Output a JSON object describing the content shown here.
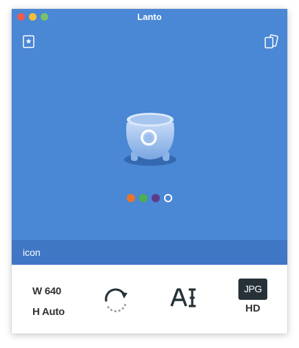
{
  "window": {
    "title": "Lanto"
  },
  "toolbar_icons": {
    "left": "bookmark-star-icon",
    "right": "copies-icon"
  },
  "preview": {
    "icon": "cauldron-icon",
    "caption": "icon"
  },
  "color_options": [
    {
      "name": "orange",
      "color": "#e8742e",
      "selected": false
    },
    {
      "name": "green",
      "color": "#4caf50",
      "selected": false
    },
    {
      "name": "purple",
      "color": "#5b3c8c",
      "selected": false
    },
    {
      "name": "white",
      "color": "#ffffff",
      "selected": true
    }
  ],
  "dimensions": {
    "width": "W 640",
    "height": "H Auto"
  },
  "format": {
    "type": "JPG",
    "quality": "HD"
  },
  "colors": {
    "accent": "#4a87d4",
    "caption_bar": "#4077c4",
    "badge": "#263238"
  }
}
